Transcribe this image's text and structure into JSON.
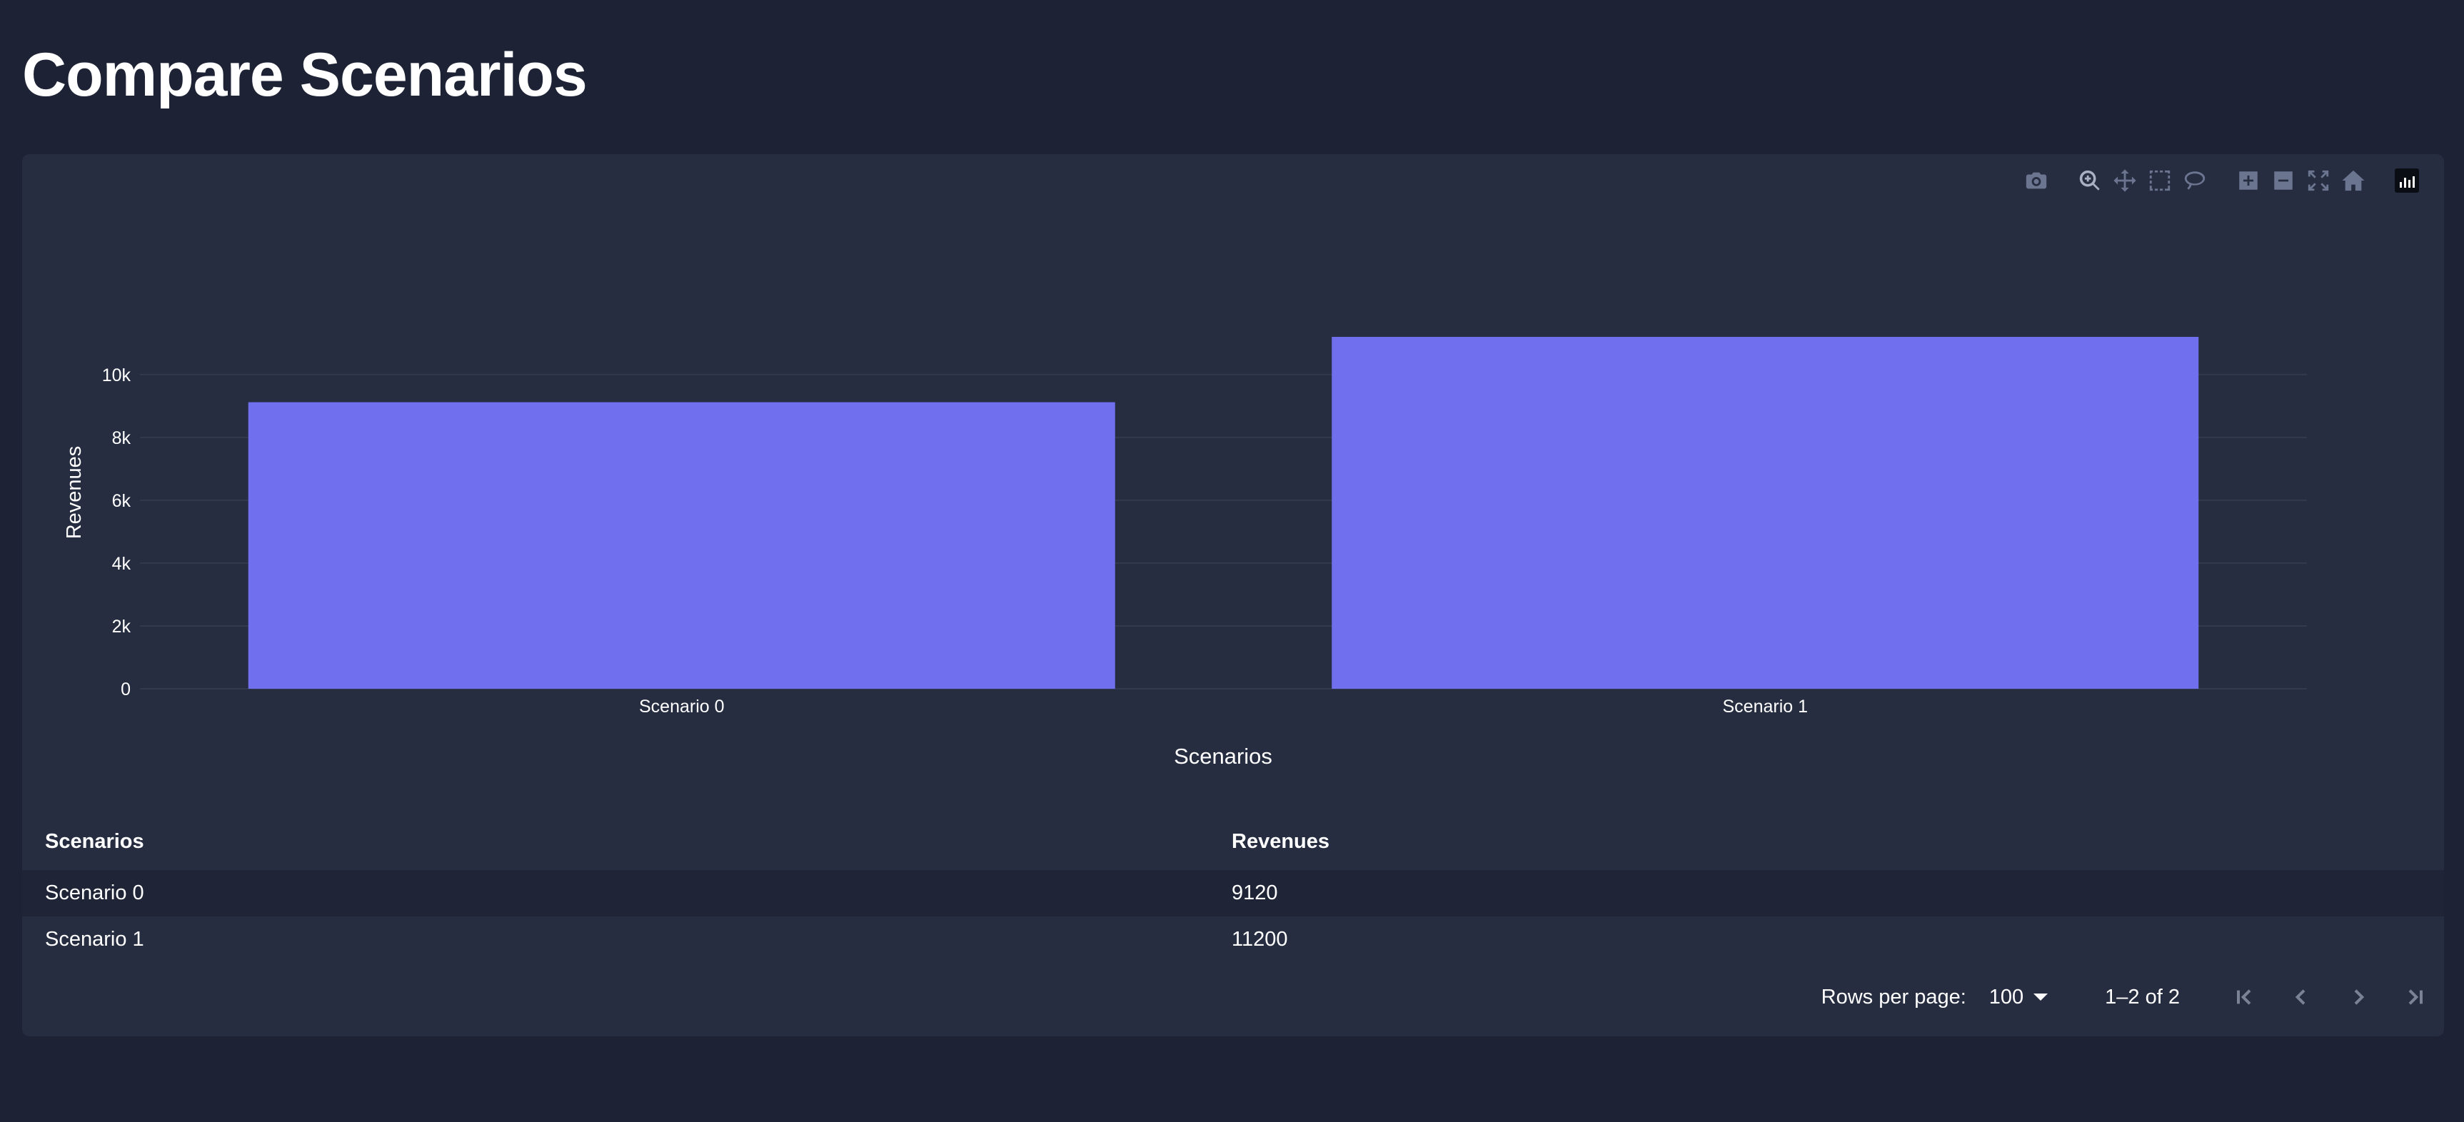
{
  "page_title": "Compare Scenarios",
  "modebar": {
    "buttons": [
      "camera-icon",
      "zoom-icon",
      "pan-icon",
      "box-select-icon",
      "lasso-select-icon",
      "zoom-in-icon",
      "zoom-out-icon",
      "autoscale-icon",
      "reset-axes-icon",
      "plotly-logo"
    ]
  },
  "colors": {
    "background": "#1e2235",
    "card": "#262d41",
    "bar": "#7070ef",
    "grid": "#323a4f"
  },
  "chart_data": {
    "type": "bar",
    "categories": [
      "Scenario 0",
      "Scenario 1"
    ],
    "values": [
      9120,
      11200
    ],
    "title": "",
    "xlabel": "Scenarios",
    "ylabel": "Revenues",
    "ylim": [
      0,
      11790
    ],
    "yticks": [
      0,
      2000,
      4000,
      6000,
      8000,
      10000
    ],
    "ytick_labels": [
      "0",
      "2k",
      "4k",
      "6k",
      "8k",
      "10k"
    ],
    "grid": true,
    "bar_color": "#7070ef"
  },
  "table": {
    "columns": [
      "Scenarios",
      "Revenues"
    ],
    "rows": [
      [
        "Scenario 0",
        "9120"
      ],
      [
        "Scenario 1",
        "11200"
      ]
    ]
  },
  "pagination": {
    "rows_per_page_label": "Rows per page:",
    "rows_per_page_value": "100",
    "range_text": "1–2 of 2"
  }
}
